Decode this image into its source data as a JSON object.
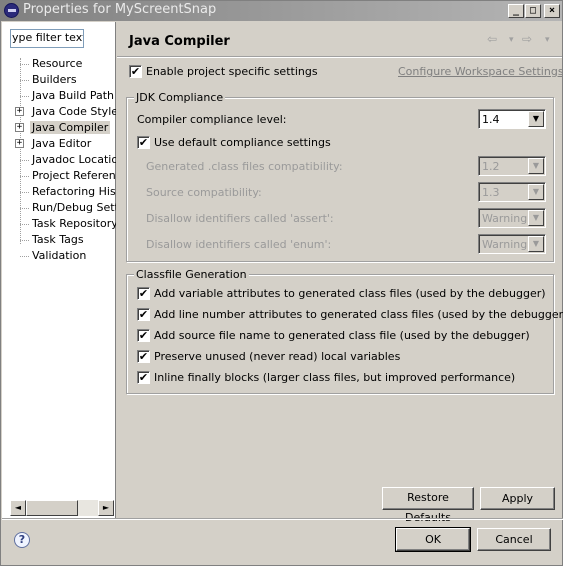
{
  "window": {
    "title": "Properties for MyScreentSnap",
    "controls": {
      "minimize": "_",
      "maximize": "□",
      "close": "×"
    }
  },
  "sidebar": {
    "filter_value": "ype filter text",
    "items": [
      {
        "label": "Resource",
        "expandable": false
      },
      {
        "label": "Builders",
        "expandable": false
      },
      {
        "label": "Java Build Path",
        "expandable": false
      },
      {
        "label": "Java Code Style",
        "expandable": true
      },
      {
        "label": "Java Compiler",
        "expandable": true,
        "selected": true
      },
      {
        "label": "Java Editor",
        "expandable": true
      },
      {
        "label": "Javadoc Location",
        "expandable": false
      },
      {
        "label": "Project References",
        "expandable": false
      },
      {
        "label": "Refactoring History",
        "expandable": false
      },
      {
        "label": "Run/Debug Settings",
        "expandable": false
      },
      {
        "label": "Task Repository",
        "expandable": false
      },
      {
        "label": "Task Tags",
        "expandable": false
      },
      {
        "label": "Validation",
        "expandable": false
      }
    ],
    "expander_symbol": "+",
    "scroll_left": "◄",
    "scroll_right": "►"
  },
  "page": {
    "title": "Java Compiler",
    "nav_back": "⇦",
    "nav_back_menu": "▾",
    "nav_forward": "⇨",
    "nav_forward_menu": "▾",
    "enable_specific": {
      "label": "Enable project specific settings",
      "checked": true
    },
    "configure_link": "Configure Workspace Settings...",
    "jdk_group": {
      "title": "JDK Compliance",
      "compliance_label": "Compiler compliance level:",
      "compliance_value": "1.4",
      "use_default": {
        "label": "Use default compliance settings",
        "checked": true
      },
      "disabled_rows": [
        {
          "label": "Generated .class files compatibility:",
          "value": "1.2"
        },
        {
          "label": "Source compatibility:",
          "value": "1.3"
        },
        {
          "label": "Disallow identifiers called 'assert':",
          "value": "Warning"
        },
        {
          "label": "Disallow identifiers called 'enum':",
          "value": "Warning"
        }
      ]
    },
    "classfile_group": {
      "title": "Classfile Generation",
      "options": [
        {
          "label": "Add variable attributes to generated class files (used by the debugger)",
          "checked": true
        },
        {
          "label": "Add line number attributes to generated class files (used by the debugger)",
          "checked": true
        },
        {
          "label": "Add source file name to generated class file (used by the debugger)",
          "checked": true
        },
        {
          "label": "Preserve unused (never read) local variables",
          "checked": true
        },
        {
          "label": "Inline finally blocks (larger class files, but improved performance)",
          "checked": true
        }
      ]
    },
    "restore_defaults": "Restore Defaults",
    "apply": "Apply"
  },
  "footer": {
    "help": "?",
    "ok": "OK",
    "cancel": "Cancel"
  },
  "check_mark": "✔",
  "dropdown_arrow": "▼"
}
